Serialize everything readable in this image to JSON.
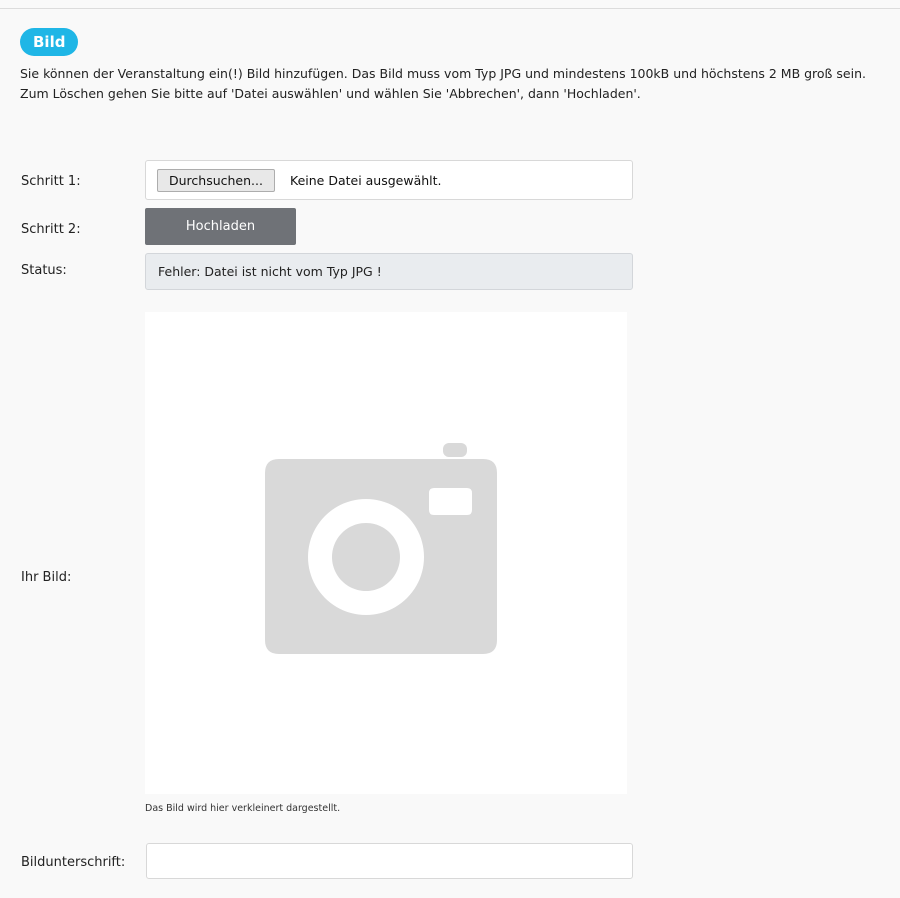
{
  "section": {
    "badge": "Bild",
    "description": "Sie können der Veranstaltung ein(!) Bild hinzufügen. Das Bild muss vom Typ JPG und mindestens 100kB und höchstens 2 MB groß sein. Zum Löschen gehen Sie bitte auf 'Datei auswählen' und wählen Sie 'Abbrechen', dann 'Hochladen'."
  },
  "step1": {
    "label": "Schritt 1:",
    "browse_label": "Durchsuchen...",
    "no_file_text": "Keine Datei ausgewählt."
  },
  "step2": {
    "label": "Schritt 2:",
    "upload_label": "Hochladen"
  },
  "status": {
    "label": "Status:",
    "message": "Fehler: Datei ist nicht vom Typ JPG !"
  },
  "image": {
    "label": "Ihr Bild:",
    "placeholder_icon": "camera-icon",
    "note": "Das Bild wird hier verkleinert dargestellt."
  },
  "caption": {
    "label": "Bildunterschrift:",
    "value": "",
    "placeholder": ""
  },
  "colors": {
    "badge": "#1fb6e6",
    "upload_button": "#6f7277",
    "status_background": "#e9ecef",
    "camera_icon": "#d9d9d9"
  }
}
